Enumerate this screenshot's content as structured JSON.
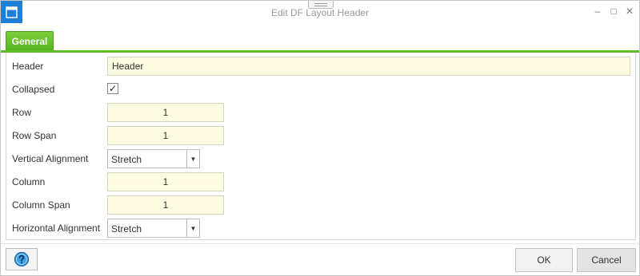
{
  "window": {
    "title": "Edit DF Layout Header",
    "icon": "window-icon",
    "controls": {
      "minimize": "–",
      "maximize": "□",
      "close": "✕"
    }
  },
  "tabs": [
    {
      "label": "General",
      "active": true,
      "color": "#5fbb28"
    }
  ],
  "form": {
    "header": {
      "label": "Header",
      "value": "Header"
    },
    "collapsed": {
      "label": "Collapsed",
      "checked": true,
      "mark": "✓"
    },
    "row": {
      "label": "Row",
      "value": "1"
    },
    "row_span": {
      "label": "Row Span",
      "value": "1"
    },
    "vertical_alignment": {
      "label": "Vertical Alignment",
      "value": "Stretch"
    },
    "column": {
      "label": "Column",
      "value": "1"
    },
    "column_span": {
      "label": "Column Span",
      "value": "1"
    },
    "horizontal_alignment": {
      "label": "Horizontal Alignment",
      "value": "Stretch"
    }
  },
  "footer": {
    "help_icon": "help-icon",
    "ok_label": "OK",
    "cancel_label": "Cancel"
  },
  "colors": {
    "accent": "#5fbb28",
    "field_background": "#fdfce0",
    "title_icon": "#1e7fd6"
  }
}
